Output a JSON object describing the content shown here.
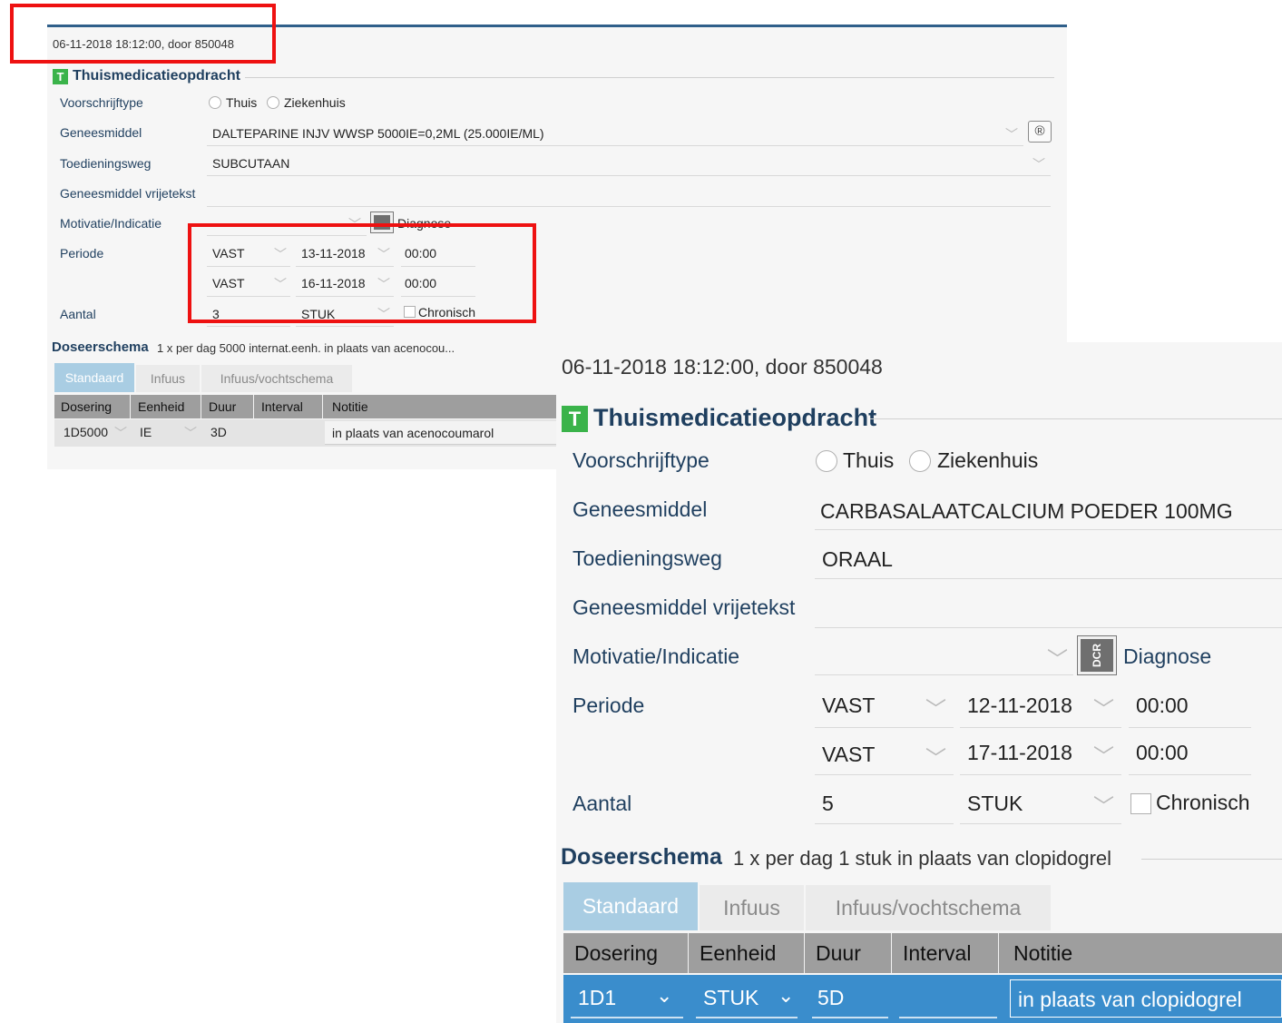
{
  "colors": {
    "accent": "#2f5f8a",
    "highlight": "#ee1111",
    "tab_active": "#a9cde3",
    "row_selected": "#3a8dcc",
    "green_icon": "#3ab34a"
  },
  "back": {
    "timestamp": "06-11-2018 18:12:00, door 850048",
    "section_icon": "T",
    "section_title": "Thuismedicatieopdracht",
    "labels": {
      "voorschrijftype": "Voorschrijftype",
      "geneesmiddel": "Geneesmiddel",
      "toedieningsweg": "Toedieningsweg",
      "vrijetekst": "Geneesmiddel vrijetekst",
      "motivatie": "Motivatie/Indicatie",
      "periode": "Periode",
      "aantal": "Aantal"
    },
    "radio_thuis": "Thuis",
    "radio_ziekenhuis": "Ziekenhuis",
    "geneesmiddel": "DALTEPARINE INJV WWSP  5000IE=0,2ML (25.000IE/ML)",
    "registered_icon": "®",
    "toedieningsweg": "SUBCUTAAN",
    "diagnose": "Diagnose",
    "periode_start": {
      "type": "VAST",
      "date": "13-11-2018",
      "time": "00:00"
    },
    "periode_end": {
      "type": "VAST",
      "date": "16-11-2018",
      "time": "00:00"
    },
    "aantal": "3",
    "eenheid": "STUK",
    "chronisch": "Chronisch",
    "dose_title": "Doseerschema",
    "dose_summary": "1 x per dag 5000 internat.eenh. in plaats van acenocou...",
    "tabs": [
      "Standaard",
      "Infuus",
      "Infuus/vochtschema"
    ],
    "table_headers": [
      "Dosering",
      "Eenheid",
      "Duur",
      "Interval",
      "Notitie"
    ],
    "row": {
      "dosering": "1D5000",
      "eenheid": "IE",
      "duur": "3D",
      "interval": "",
      "notitie": "in plaats van acenocoumarol"
    }
  },
  "front": {
    "timestamp": "06-11-2018 18:12:00, door 850048",
    "section_icon": "T",
    "section_title": "Thuismedicatieopdracht",
    "labels": {
      "voorschrijftype": "Voorschrijftype",
      "geneesmiddel": "Geneesmiddel",
      "toedieningsweg": "Toedieningsweg",
      "vrijetekst": "Geneesmiddel vrijetekst",
      "motivatie": "Motivatie/Indicatie",
      "periode": "Periode",
      "aantal": "Aantal"
    },
    "radio_thuis": "Thuis",
    "radio_ziekenhuis": "Ziekenhuis",
    "geneesmiddel": "CARBASALAATCALCIUM POEDER 100MG",
    "toedieningsweg": "ORAAL",
    "dcr_icon": "DCR",
    "diagnose": "Diagnose",
    "periode_start": {
      "type": "VAST",
      "date": "12-11-2018",
      "time": "00:00"
    },
    "periode_end": {
      "type": "VAST",
      "date": "17-11-2018",
      "time": "00:00"
    },
    "aantal": "5",
    "eenheid": "STUK",
    "chronisch": "Chronisch",
    "dose_title": "Doseerschema",
    "dose_summary": "1 x per dag 1 stuk in plaats van clopidogrel",
    "tabs": [
      "Standaard",
      "Infuus",
      "Infuus/vochtschema"
    ],
    "table_headers": [
      "Dosering",
      "Eenheid",
      "Duur",
      "Interval",
      "Notitie"
    ],
    "row": {
      "dosering": "1D1",
      "eenheid": "STUK",
      "duur": "5D",
      "interval": "",
      "notitie": "in plaats van clopidogrel"
    }
  }
}
